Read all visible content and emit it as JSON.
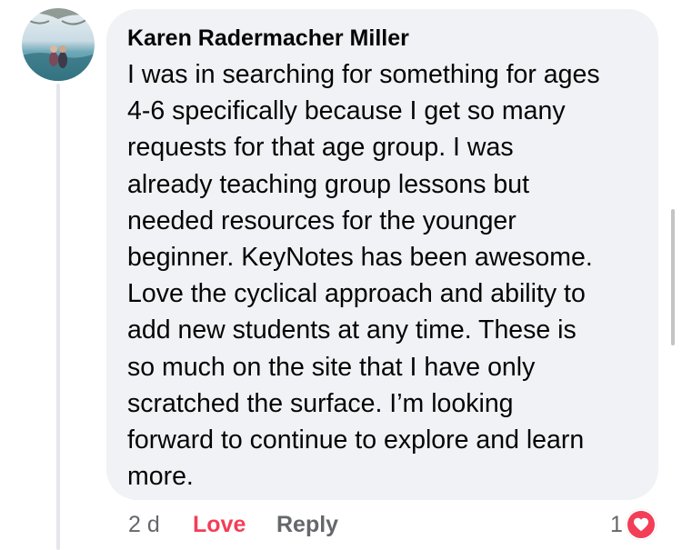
{
  "comment": {
    "author": "Karen Radermacher Miller",
    "text": "I was in searching for something for ages\n4-6 specifically because I get so many\nrequests for that age group. I was\nalready teaching group lessons but\nneeded resources for the younger\nbeginner. KeyNotes has been awesome.\nLove the cyclical approach and ability to\nadd new students at any time. These is\nso much on the site that I have only\nscratched the surface. I’m looking\nforward to continue to explore and learn\nmore.",
    "avatar_icon": "profile-photo",
    "timestamp": "2 d",
    "love_label": "Love",
    "reply_label": "Reply",
    "reaction_count": "1",
    "reaction_icon": "heart-icon"
  },
  "colors": {
    "bubble": "#f0f2f5",
    "text": "#050505",
    "muted": "#65676b",
    "love": "#f33e58",
    "thread_line": "#e4e6eb"
  }
}
